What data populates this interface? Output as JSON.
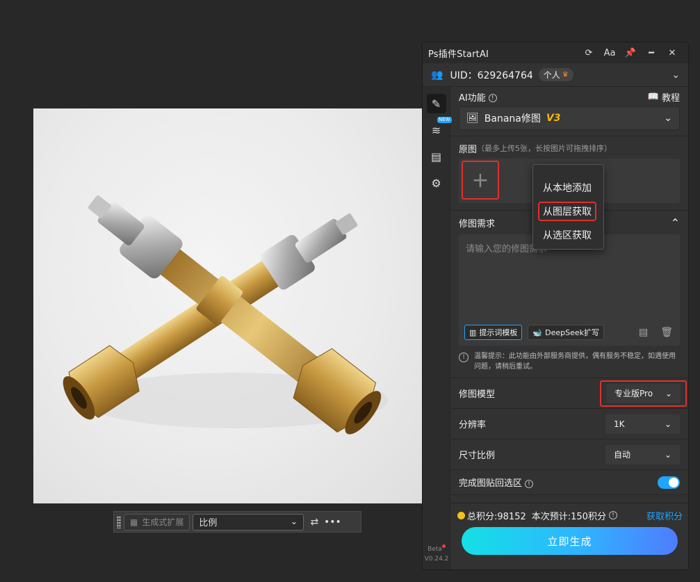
{
  "canvas": {
    "photo_alt": ""
  },
  "ctxbar": {
    "expand_label": "生成式扩展",
    "ratio_select": "比例",
    "more_label": "•••"
  },
  "panel": {
    "title": "Ps插件StartAI",
    "titlebar_icons": [
      "refresh-icon",
      "font-size-icon",
      "pin-icon",
      "minimize-icon",
      "close-icon"
    ],
    "font_label": "Aa",
    "user": {
      "uid": "UID：629264764",
      "badge": "个人"
    },
    "rail": {
      "new_badge": "NEW",
      "version_beta": "Beta",
      "version": "V0.24.2"
    },
    "ai": {
      "title": "AI功能",
      "tutorial": "教程",
      "feature": "Banana修图",
      "feature_version": "V3"
    },
    "original": {
      "title": "原图",
      "hint": "（最多上传5张，长按图片可拖拽排序）",
      "add_symbol": "+"
    },
    "menu": {
      "items": [
        "从本地添加",
        "从图层获取",
        "从选区获取"
      ]
    },
    "requirement": {
      "title": "修图需求",
      "placeholder": "请输入您的修图需求",
      "template_btn": "提示词模板",
      "deepseek_btn": "DeepSeek扩写"
    },
    "notice": "温馨提示：此功能由外部服务商提供，偶有服务不稳定，如遇使用问题，请稍后重试。",
    "settings": {
      "model_label": "修图模型",
      "model_value": "专业版Pro",
      "resolution_label": "分辨率",
      "resolution_value": "1K",
      "ratio_label": "尺寸比例",
      "ratio_value": "自动",
      "paste_label": "完成图贴回选区",
      "paste_on": true
    },
    "footer": {
      "total_points": "总积分:98152",
      "estimate": "本次预计:150积分",
      "get_points": "获取积分",
      "generate": "立即生成"
    }
  },
  "colors": {
    "accent": "#1ea6ff",
    "highlight": "#e0302a",
    "gold": "#f5b80f"
  }
}
